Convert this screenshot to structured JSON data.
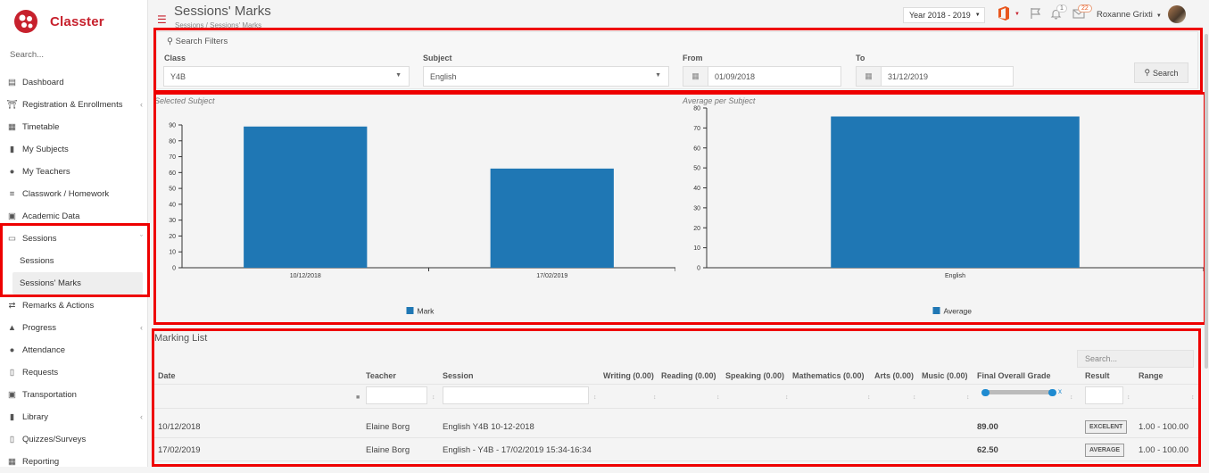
{
  "app": {
    "name": "Classter",
    "search_placeholder": "Search..."
  },
  "sidebar": {
    "items": [
      {
        "label": "Dashboard",
        "icon": "laptop-icon"
      },
      {
        "label": "Registration & Enrollments",
        "icon": "bank-icon",
        "has_chevron": true
      },
      {
        "label": "Timetable",
        "icon": "calendar-icon"
      },
      {
        "label": "My Subjects",
        "icon": "book-icon"
      },
      {
        "label": "My Teachers",
        "icon": "users-icon"
      },
      {
        "label": "Classwork / Homework",
        "icon": "list-icon"
      },
      {
        "label": "Academic Data",
        "icon": "id-card-icon"
      },
      {
        "label": "Sessions",
        "icon": "chalkboard-icon",
        "has_chevron": true,
        "expanded": true
      },
      {
        "label": "Remarks & Actions",
        "icon": "shuffle-icon"
      },
      {
        "label": "Progress",
        "icon": "graduation-cap-icon",
        "has_chevron": true
      },
      {
        "label": "Attendance",
        "icon": "user-check-icon"
      },
      {
        "label": "Requests",
        "icon": "file-icon"
      },
      {
        "label": "Transportation",
        "icon": "bus-icon"
      },
      {
        "label": "Library",
        "icon": "library-icon",
        "has_chevron": true
      },
      {
        "label": "Quizzes/Surveys",
        "icon": "clipboard-icon"
      },
      {
        "label": "Reporting",
        "icon": "printer-icon"
      }
    ],
    "sessions_sub": [
      {
        "label": "Sessions"
      },
      {
        "label": "Sessions' Marks",
        "active": true
      }
    ]
  },
  "header": {
    "title": "Sessions' Marks",
    "breadcrumb": "Sessions / Sessions' Marks",
    "year": "Year 2018 - 2019",
    "flag_count": "1",
    "mail_count": "22",
    "user": "Roxanne Grixti"
  },
  "filters": {
    "legend": "Search Filters",
    "class_label": "Class",
    "class_value": "Y4B",
    "subject_label": "Subject",
    "subject_value": "English",
    "from_label": "From",
    "from_value": "01/09/2018",
    "to_label": "To",
    "to_value": "31/12/2019",
    "search_button": "Search"
  },
  "chart_data": [
    {
      "type": "bar",
      "title": "Selected Subject",
      "categories": [
        "10/12/2018",
        "17/02/2019"
      ],
      "series": [
        {
          "name": "Mark",
          "values": [
            89,
            62.5
          ]
        }
      ],
      "ylim": [
        0,
        90
      ],
      "yticks": [
        0,
        10,
        20,
        30,
        40,
        50,
        60,
        70,
        80,
        90
      ],
      "legend": "bottom",
      "color": "#1f77b4"
    },
    {
      "type": "bar",
      "title": "Average per Subject",
      "categories": [
        "English"
      ],
      "series": [
        {
          "name": "Average",
          "values": [
            75.75
          ]
        }
      ],
      "ylim": [
        0,
        80
      ],
      "yticks": [
        0,
        10,
        20,
        30,
        40,
        50,
        60,
        70,
        80
      ],
      "legend": "bottom",
      "color": "#1f77b4"
    }
  ],
  "marking": {
    "title": "Marking List",
    "search_placeholder": "Search...",
    "columns": [
      "Date",
      "Teacher",
      "Session",
      "Writing (0.00)",
      "Reading (0.00)",
      "Speaking (0.00)",
      "Mathematics (0.00)",
      "Arts (0.00)",
      "Music (0.00)",
      "Final Overall Grade",
      "Result",
      "Range"
    ],
    "rows": [
      {
        "date": "10/12/2018",
        "teacher": "Elaine Borg",
        "session": "English Y4B 10-12-2018",
        "grade": "89.00",
        "result": "EXCELENT",
        "range": "1.00 - 100.00"
      },
      {
        "date": "17/02/2019",
        "teacher": "Elaine Borg",
        "session": "English - Y4B - 17/02/2019 15:34-16:34",
        "grade": "62.50",
        "result": "AVERAGE",
        "range": "1.00 - 100.00"
      }
    ],
    "range_clear": "x"
  },
  "colors": {
    "brand": "#c7212d",
    "bar": "#1f77b4",
    "highlight": "#e00000"
  }
}
